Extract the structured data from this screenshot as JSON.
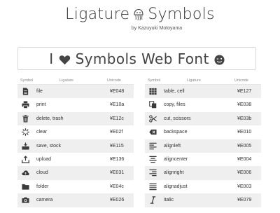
{
  "header": {
    "title_left": "Ligature",
    "title_right": "Symbols",
    "byline": "by Kazuyuki Motoyama"
  },
  "banner": {
    "text_left": "I",
    "text_right": "Symbols Web Font"
  },
  "columns": {
    "symbol": "Symbol",
    "ligature": "Ligature",
    "unicode": "Unicode"
  },
  "left_table": [
    {
      "icon": "file-icon",
      "ligature": "file",
      "unicode": "¥E048"
    },
    {
      "icon": "print-icon",
      "ligature": "print",
      "unicode": "¥E10a"
    },
    {
      "icon": "trash-icon",
      "ligature": "delete, trash",
      "unicode": "¥E12c"
    },
    {
      "icon": "spinner-icon",
      "ligature": "clear",
      "unicode": "¥E02f"
    },
    {
      "icon": "save-icon",
      "ligature": "save, stock",
      "unicode": "¥E115"
    },
    {
      "icon": "upload-icon",
      "ligature": "upload",
      "unicode": "¥E136"
    },
    {
      "icon": "cloud-icon",
      "ligature": "cloud",
      "unicode": "¥E031"
    },
    {
      "icon": "folder-icon",
      "ligature": "folder",
      "unicode": "¥E04c"
    },
    {
      "icon": "camera-icon",
      "ligature": "camera",
      "unicode": "¥E026"
    }
  ],
  "right_table": [
    {
      "icon": "table-icon",
      "ligature": "table, cell",
      "unicode": "¥E127"
    },
    {
      "icon": "copy-icon",
      "ligature": "copy, files",
      "unicode": "¥E038"
    },
    {
      "icon": "scissors-icon",
      "ligature": "cut, scissors",
      "unicode": "¥E03b"
    },
    {
      "icon": "backspace-icon",
      "ligature": "backspace",
      "unicode": "¥E010"
    },
    {
      "icon": "align-left-icon",
      "ligature": "alignleft",
      "unicode": "¥E005"
    },
    {
      "icon": "align-center-icon",
      "ligature": "aligncenter",
      "unicode": "¥E004"
    },
    {
      "icon": "align-right-icon",
      "ligature": "alignright",
      "unicode": "¥E006"
    },
    {
      "icon": "align-justify-icon",
      "ligature": "alignadjust",
      "unicode": "¥E003"
    },
    {
      "icon": "italic-icon",
      "ligature": "italic",
      "unicode": "¥E079"
    }
  ],
  "colors": {
    "row_alt": "#efefef",
    "icon": "#3a3a3a",
    "text": "#333333"
  }
}
